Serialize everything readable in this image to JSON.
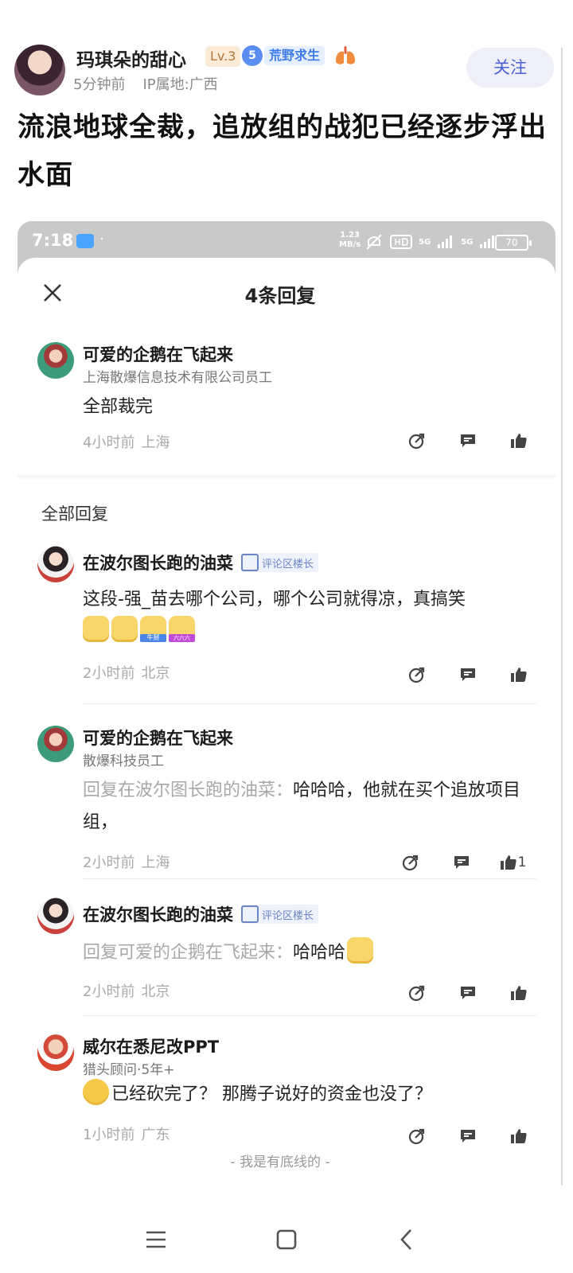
{
  "post": {
    "author_name": "玛琪朵的甜心",
    "level": "Lv.3",
    "medal_number": "5",
    "medal_label": "荒野求生",
    "time_ago": "5分钟前",
    "ip_location": "IP属地:广西",
    "follow_label": "关注",
    "title": "流浪地球全裁，追放组的战犯已经逐步浮出水面"
  },
  "embedded_status": {
    "time": "7:18",
    "net_speed_value": "1.23",
    "net_speed_unit": "MB/s",
    "signal1": "5G",
    "signal2": "5G",
    "battery": "70"
  },
  "sheet": {
    "title": "4条回复",
    "section_title": "全部回复",
    "footer": "- 我是有底线的 -"
  },
  "top_comment": {
    "name": "可爱的企鹅在飞起来",
    "sub": "上海散爆信息技术有限公司员工",
    "text": "全部裁完",
    "time": "4小时前",
    "location": "上海"
  },
  "replies": [
    {
      "name": "在波尔图长跑的油菜",
      "tag": "评论区楼长",
      "text": "这段-强_苗去哪个公司，哪个公司就得凉，真搞笑",
      "time": "2小时前",
      "location": "北京"
    },
    {
      "name": "可爱的企鹅在飞起来",
      "sub": "散爆科技员工",
      "reply_prefix": "回复在波尔图长跑的油菜：",
      "text": "哈哈哈，他就在买个追放项目组，",
      "time": "2小时前",
      "location": "上海",
      "like_count": "1"
    },
    {
      "name": "在波尔图长跑的油菜",
      "tag": "评论区楼长",
      "reply_prefix": "回复可爱的企鹅在飞起来：",
      "text": "哈哈哈",
      "time": "2小时前",
      "location": "北京"
    },
    {
      "name": "威尔在悉尼改PPT",
      "sub": "猎头顾问·5年+",
      "text": "已经砍完了？ 那腾子说好的资金也没了？",
      "time": "1小时前",
      "location": "广东"
    }
  ],
  "emoji_labels": [
    "牛掰",
    "六六六"
  ],
  "colors": {
    "follow_text": "#4a5fd1",
    "follow_bg": "#eeeff8",
    "medal_blue": "#3d7bea",
    "level_orange": "#b5773a"
  }
}
